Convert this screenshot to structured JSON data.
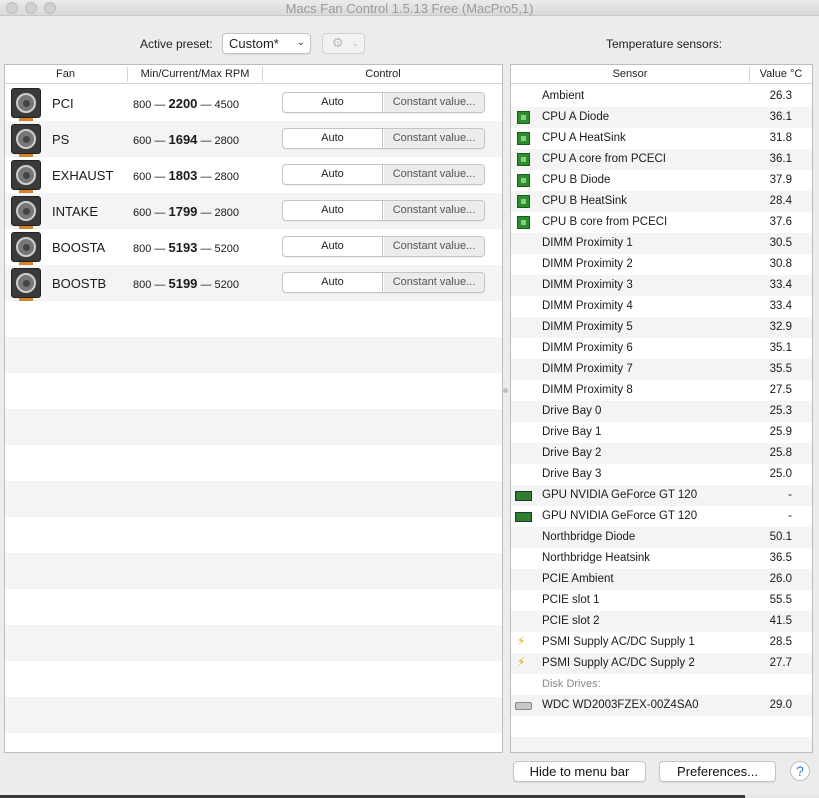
{
  "window": {
    "title": "Macs Fan Control 1.5.13 Free (MacPro5,1)"
  },
  "toolbar": {
    "active_preset_label": "Active preset:",
    "preset_value": "Custom*",
    "temperature_sensors_label": "Temperature sensors:"
  },
  "fan_table": {
    "headers": {
      "fan": "Fan",
      "rpm": "Min/Current/Max RPM",
      "control": "Control"
    },
    "auto_label": "Auto",
    "constant_label": "Constant value...",
    "dash": "—",
    "fans": [
      {
        "name": "PCI",
        "min": "800",
        "current": "2200",
        "max": "4500"
      },
      {
        "name": "PS",
        "min": "600",
        "current": "1694",
        "max": "2800"
      },
      {
        "name": "EXHAUST",
        "min": "600",
        "current": "1803",
        "max": "2800"
      },
      {
        "name": "INTAKE",
        "min": "600",
        "current": "1799",
        "max": "2800"
      },
      {
        "name": "BOOSTA",
        "min": "800",
        "current": "5193",
        "max": "5200"
      },
      {
        "name": "BOOSTB",
        "min": "800",
        "current": "5199",
        "max": "5200"
      }
    ]
  },
  "sensor_table": {
    "headers": {
      "sensor": "Sensor",
      "value": "Value °C"
    },
    "sensors": [
      {
        "icon": "none",
        "name": "Ambient",
        "value": "26.3"
      },
      {
        "icon": "cpu-chip-icon",
        "name": "CPU A Diode",
        "value": "36.1"
      },
      {
        "icon": "cpu-chip-icon",
        "name": "CPU A HeatSink",
        "value": "31.8"
      },
      {
        "icon": "cpu-chip-icon",
        "name": "CPU A core from PCECI",
        "value": "36.1"
      },
      {
        "icon": "cpu-chip-icon",
        "name": "CPU B Diode",
        "value": "37.9"
      },
      {
        "icon": "cpu-chip-icon",
        "name": "CPU B HeatSink",
        "value": "28.4"
      },
      {
        "icon": "cpu-chip-icon",
        "name": "CPU B core from PCECI",
        "value": "37.6"
      },
      {
        "icon": "none",
        "name": "DIMM Proximity 1",
        "value": "30.5"
      },
      {
        "icon": "none",
        "name": "DIMM Proximity 2",
        "value": "30.8"
      },
      {
        "icon": "none",
        "name": "DIMM Proximity 3",
        "value": "33.4"
      },
      {
        "icon": "none",
        "name": "DIMM Proximity 4",
        "value": "33.4"
      },
      {
        "icon": "none",
        "name": "DIMM Proximity 5",
        "value": "32.9"
      },
      {
        "icon": "none",
        "name": "DIMM Proximity 6",
        "value": "35.1"
      },
      {
        "icon": "none",
        "name": "DIMM Proximity 7",
        "value": "35.5"
      },
      {
        "icon": "none",
        "name": "DIMM Proximity 8",
        "value": "27.5"
      },
      {
        "icon": "none",
        "name": "Drive Bay 0",
        "value": "25.3"
      },
      {
        "icon": "none",
        "name": "Drive Bay 1",
        "value": "25.9"
      },
      {
        "icon": "none",
        "name": "Drive Bay 2",
        "value": "25.8"
      },
      {
        "icon": "none",
        "name": "Drive Bay 3",
        "value": "25.0"
      },
      {
        "icon": "gpu-card-icon",
        "name": "GPU NVIDIA GeForce GT 120",
        "value": "-"
      },
      {
        "icon": "gpu-card-icon",
        "name": "GPU NVIDIA GeForce GT 120",
        "value": "-"
      },
      {
        "icon": "none",
        "name": "Northbridge Diode",
        "value": "50.1"
      },
      {
        "icon": "none",
        "name": "Northbridge Heatsink",
        "value": "36.5"
      },
      {
        "icon": "none",
        "name": "PCIE Ambient",
        "value": "26.0"
      },
      {
        "icon": "none",
        "name": "PCIE slot 1",
        "value": "55.5"
      },
      {
        "icon": "none",
        "name": "PCIE slot 2",
        "value": "41.5"
      },
      {
        "icon": "lightning-bolt-icon",
        "name": "PSMI Supply AC/DC Supply 1",
        "value": "28.5"
      },
      {
        "icon": "lightning-bolt-icon",
        "name": "PSMI Supply AC/DC Supply 2",
        "value": "27.7"
      }
    ],
    "disk_group_label": "Disk Drives:",
    "disks": [
      {
        "icon": "hard-drive-icon",
        "name": "WDC WD2003FZEX-00Z4SA0",
        "value": "29.0"
      }
    ]
  },
  "footer": {
    "hide_button": "Hide to menu bar",
    "preferences_button": "Preferences...",
    "help_button": "?"
  }
}
